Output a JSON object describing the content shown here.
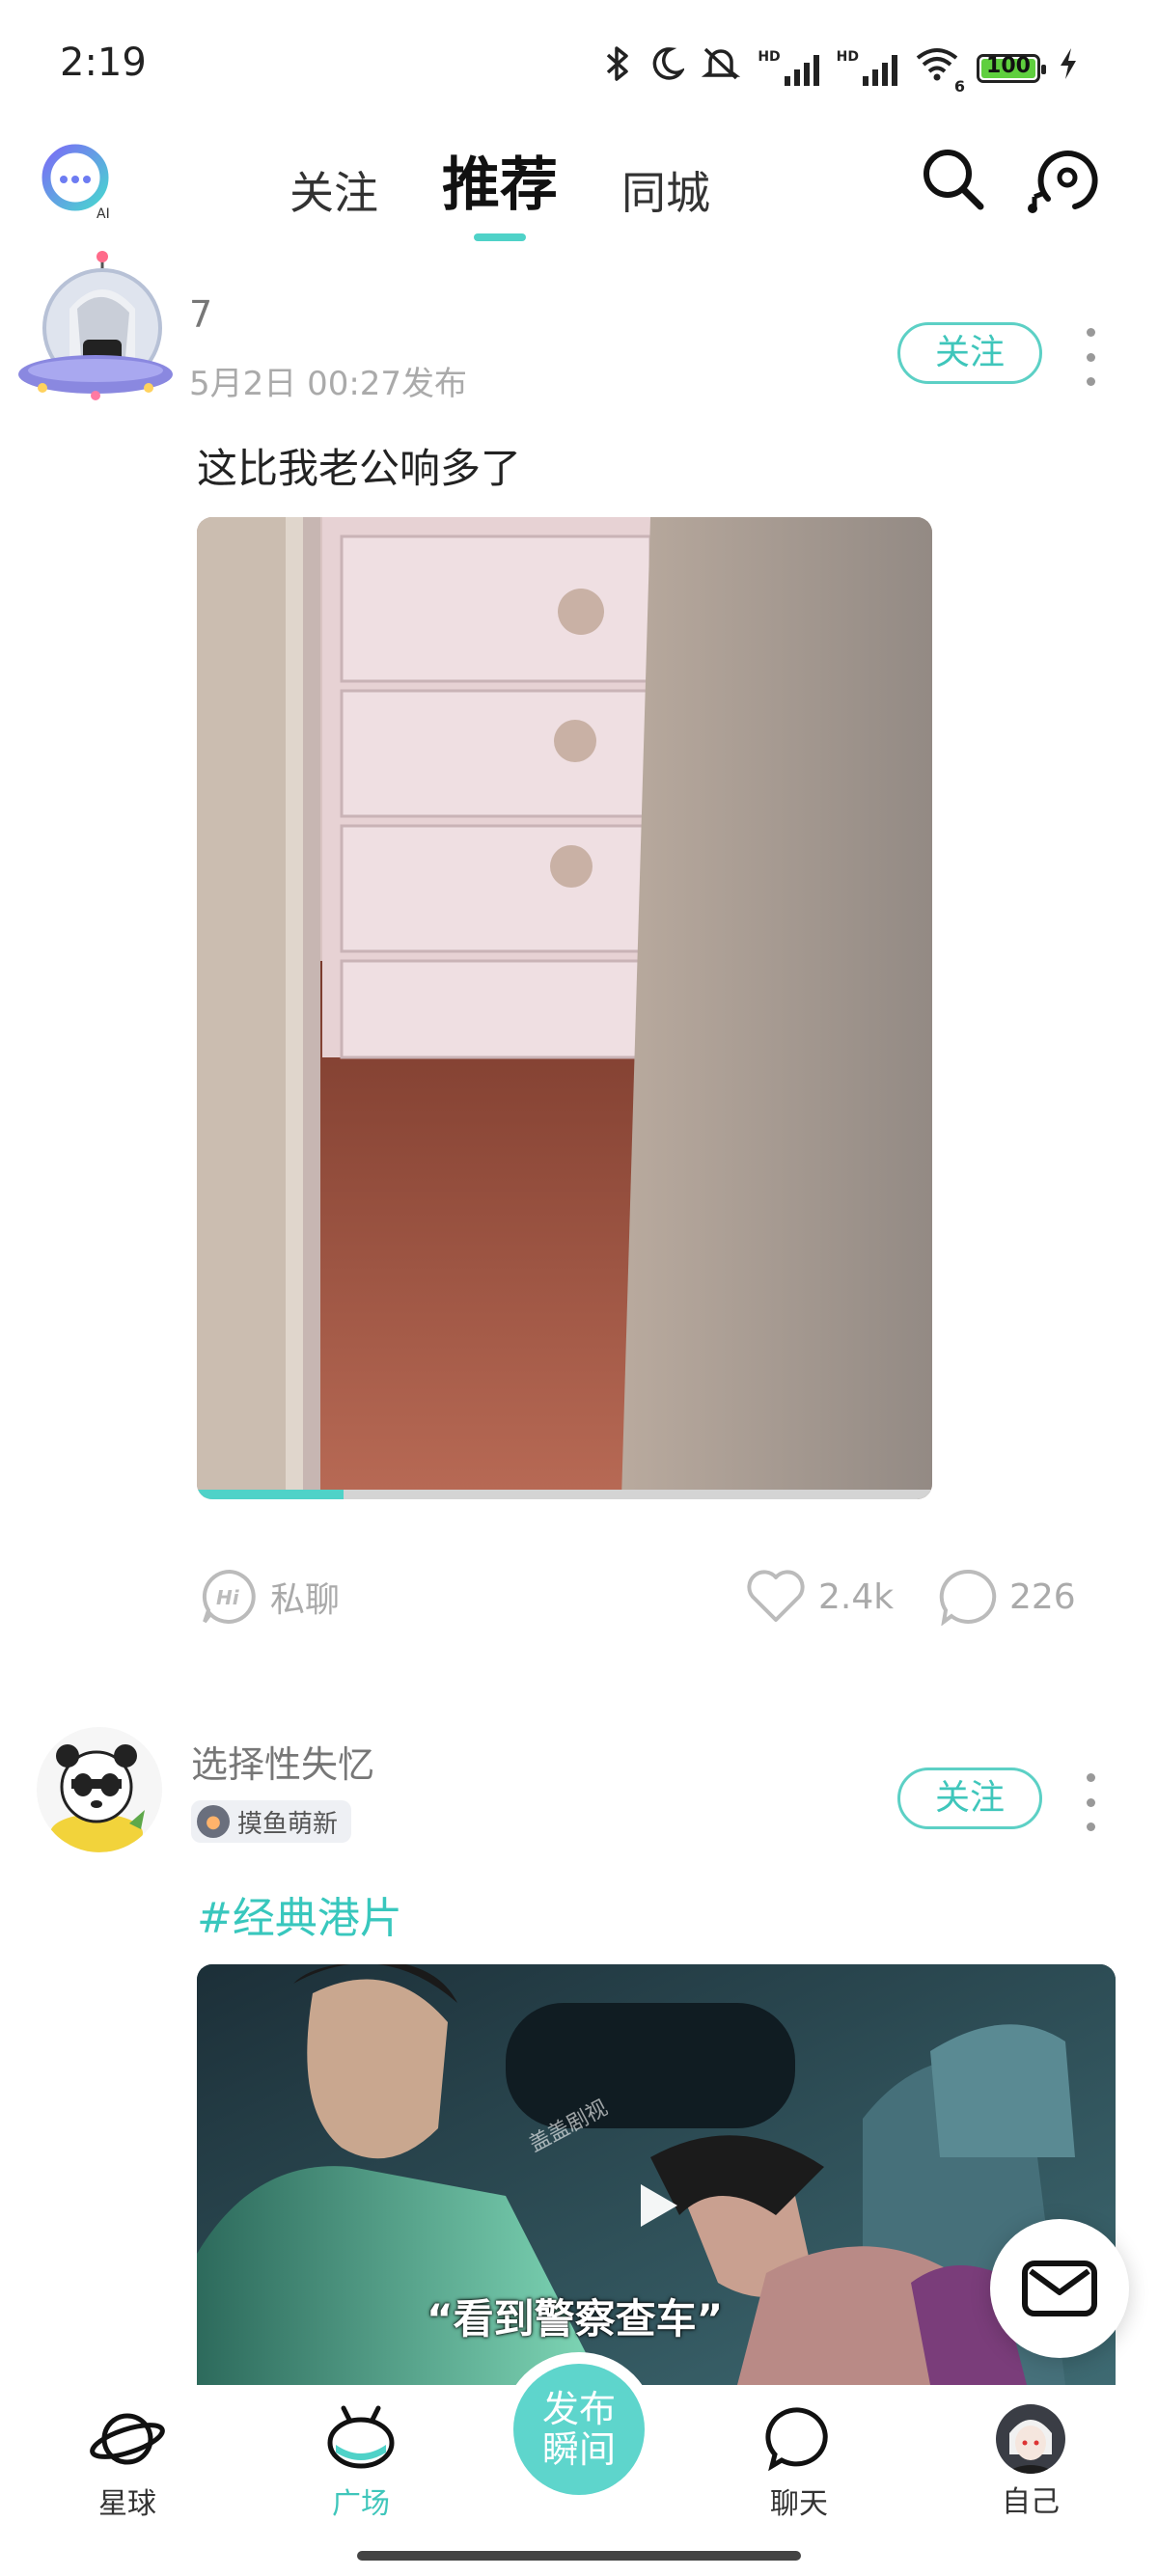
{
  "status_bar": {
    "time": "2:19",
    "battery": "100",
    "icons": [
      "bluetooth-icon",
      "moon-icon",
      "mute-icon",
      "signal-icon",
      "signal-icon",
      "wifi-icon",
      "battery-icon",
      "charging-icon"
    ],
    "hd_label": "HD",
    "wifi_label": "6"
  },
  "top_nav": {
    "tabs": [
      {
        "label": "关注"
      },
      {
        "label": "推荐",
        "active": true
      },
      {
        "label": "同城"
      }
    ],
    "logo_caption": "AI",
    "icons": [
      "search-icon",
      "music-icon"
    ]
  },
  "posts": [
    {
      "username": "7",
      "time": "5月2日 00:27发布",
      "follow_label": "关注",
      "text": "这比我老公响多了",
      "progress": 0.2,
      "actions": {
        "chat_label": "私聊",
        "likes": "2.4k",
        "comments": "226"
      }
    },
    {
      "username": "选择性失忆",
      "badge": "摸鱼萌新",
      "follow_label": "关注",
      "hashtag": "#经典港片",
      "video_caption": "“看到警察查车”",
      "watermark": "盖盖剧视"
    }
  ],
  "bottom_nav": {
    "items": [
      {
        "label": "星球"
      },
      {
        "label": "广场",
        "active": true
      },
      {
        "label": "聊天"
      },
      {
        "label": "自己"
      }
    ],
    "publish_label_1": "发布",
    "publish_label_2": "瞬间"
  },
  "colors": {
    "accent": "#4fd2c8",
    "accent_text": "#3fc6bb"
  }
}
